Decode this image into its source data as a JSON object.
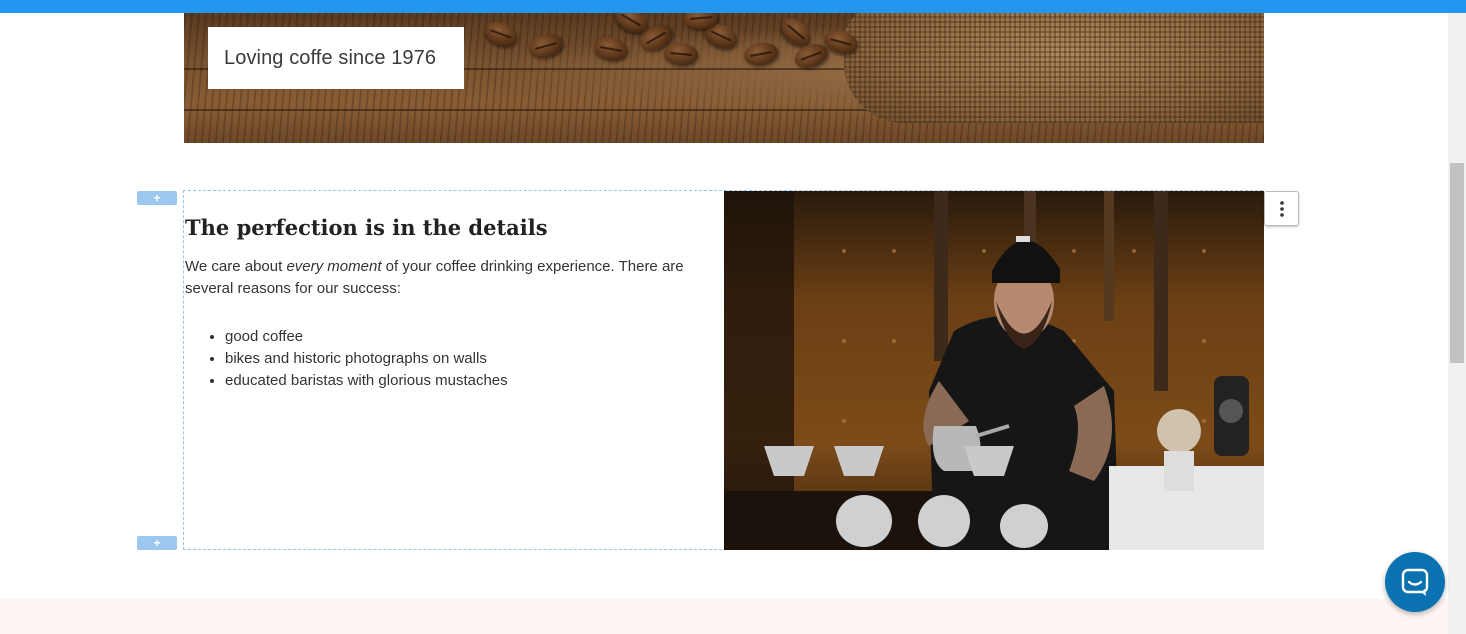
{
  "hero": {
    "caption": "Loving coffe since 1976"
  },
  "section": {
    "add_handle_label": "+",
    "heading": "The perfection is in the details",
    "paragraph": {
      "before": "We care about ",
      "emphasis": "every moment",
      "after": " of your coffee drinking experience. There are several reasons for our success:"
    },
    "bullets": [
      "good coffee",
      "bikes and historic photographs on walls",
      "educated baristas with glorious mustaches"
    ],
    "menu_icon": "more-vertical-icon"
  },
  "colors": {
    "top_bar": "#2196f3",
    "section_border": "#9cc4e4",
    "chat_button": "#0a72b0",
    "bottom_band": "#fff5f3"
  },
  "icons": {
    "chat": "chat-bubble-icon",
    "menu": "vertical-dots-icon"
  }
}
